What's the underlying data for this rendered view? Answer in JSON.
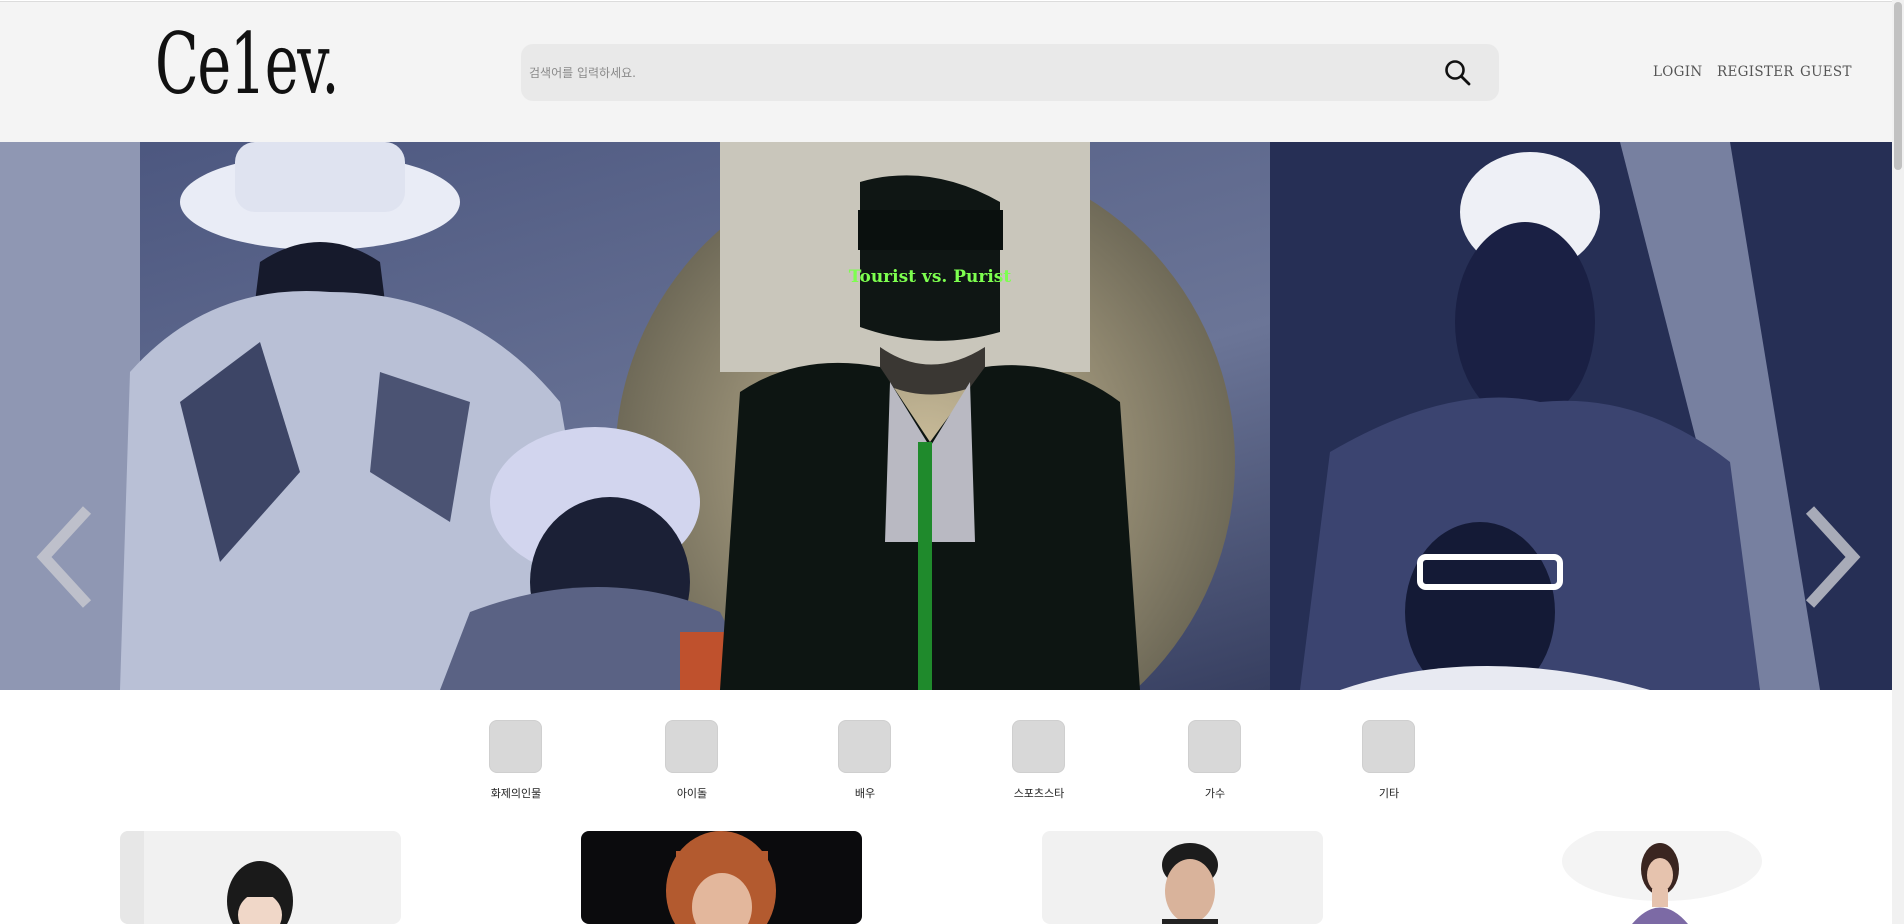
{
  "header": {
    "logo": "Ce1ev.",
    "search_placeholder": "검색어를 입력하세요.",
    "nav": {
      "login": "LOGIN",
      "register": "REGISTER",
      "guest": "GUEST"
    }
  },
  "hero": {
    "cap_text": "Tourist vs. Purist",
    "colors": {
      "overlay": "#2a3356",
      "accent_circle": "#d8c9a6",
      "cap_text": "#7dff4f"
    }
  },
  "categories": [
    {
      "label": "화제의인물"
    },
    {
      "label": "아이돌"
    },
    {
      "label": "배우"
    },
    {
      "label": "스포츠스타"
    },
    {
      "label": "가수"
    },
    {
      "label": "기타"
    }
  ],
  "cards": [
    {
      "background": "#f1f1f1"
    },
    {
      "background": "#0b0b0d"
    },
    {
      "background": "#f1f1f1"
    },
    {
      "background": "#ffffff"
    }
  ]
}
